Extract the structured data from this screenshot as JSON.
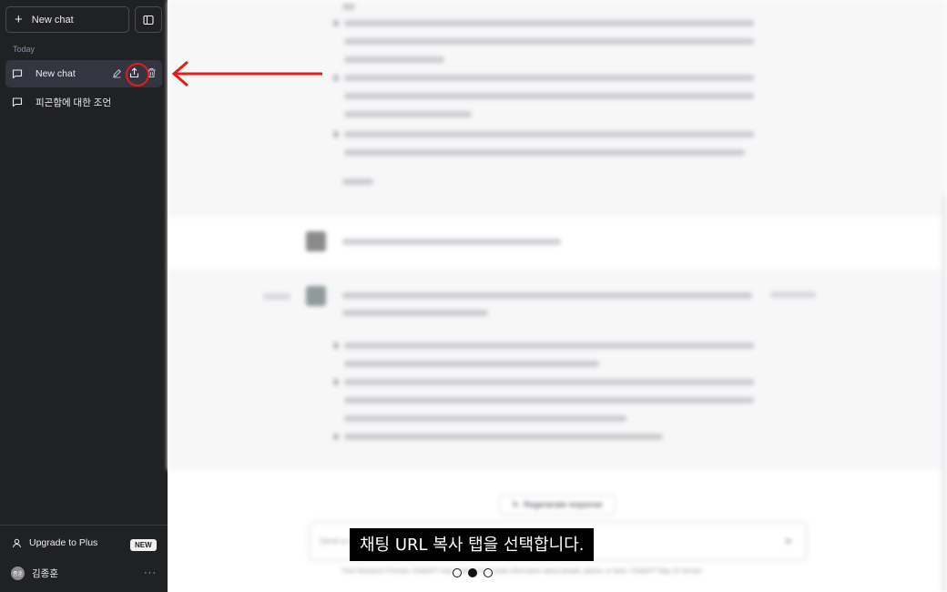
{
  "sidebar": {
    "new_chat_label": "New chat",
    "section_label": "Today",
    "items": [
      {
        "label": "New chat",
        "active": true
      },
      {
        "label": "피곤함에 대한 조언",
        "active": false
      }
    ],
    "upgrade_label": "Upgrade to Plus",
    "new_badge": "NEW",
    "user_name": "김종훈",
    "user_initials": "종훈",
    "more_label": "···"
  },
  "main": {
    "regenerate_label": "Regenerate response",
    "input_placeholder": "Send a message.",
    "footer": "Free Research Preview. ChatGPT may produce inaccurate information about people, places, or facts. ChatGPT May 24 Version",
    "page_indicator": "< 2/2 >"
  },
  "annotation": {
    "caption": "채팅 URL 복사 탭을 선택합니다.",
    "arrow_color": "#e11d1d",
    "slides_total": 3,
    "slide_active": 2
  },
  "colors": {
    "sidebar_bg": "#202123",
    "active_item_bg": "#343541",
    "highlight": "#e11d1d"
  }
}
